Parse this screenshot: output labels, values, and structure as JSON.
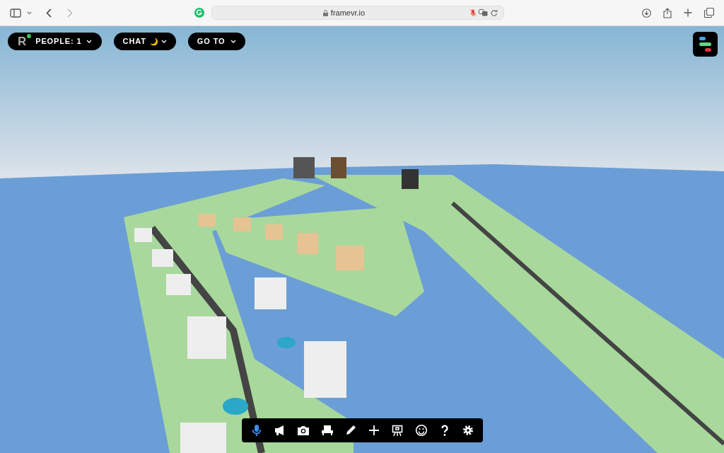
{
  "browser": {
    "url": "framevr.io"
  },
  "people_button": {
    "avatar_initial": "R",
    "online": true,
    "label": "PEOPLE: 1"
  },
  "chat_button": {
    "label": "CHAT"
  },
  "goto_button": {
    "label": "GO TO"
  },
  "toolbar": [
    {
      "kind": "mic",
      "active": true
    },
    {
      "kind": "megaphone",
      "active": false
    },
    {
      "kind": "camera",
      "active": false
    },
    {
      "kind": "seat",
      "active": false
    },
    {
      "kind": "pencil",
      "active": false
    },
    {
      "kind": "plus",
      "active": false
    },
    {
      "kind": "presentation",
      "active": false
    },
    {
      "kind": "emoji",
      "active": false
    },
    {
      "kind": "help",
      "active": false
    },
    {
      "kind": "settings",
      "active": false
    }
  ]
}
